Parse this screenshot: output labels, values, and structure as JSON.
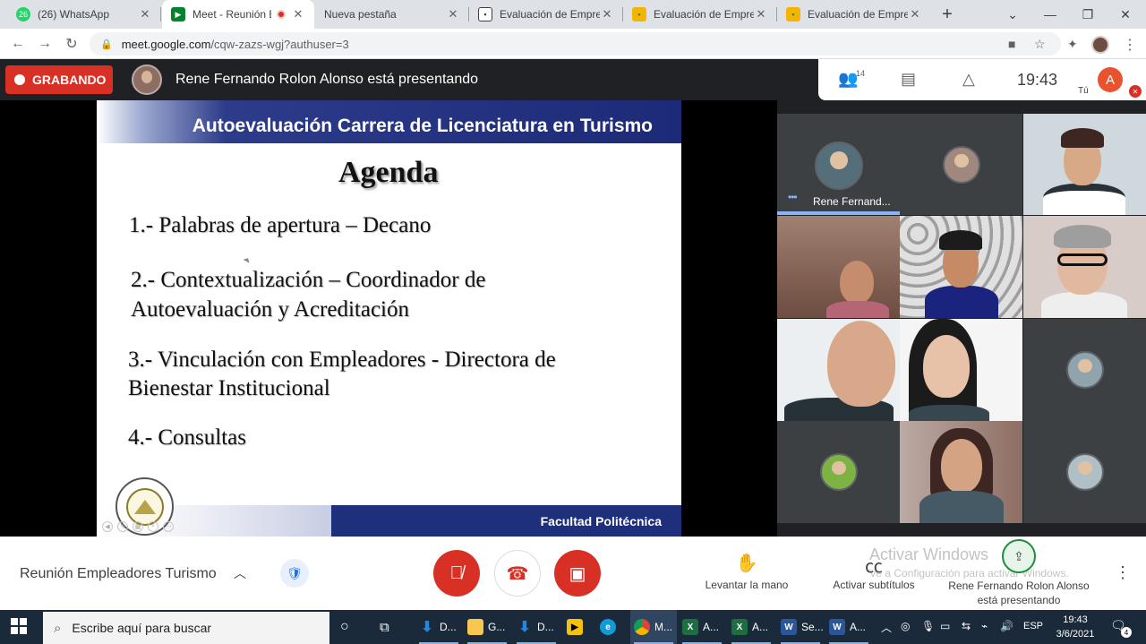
{
  "browser": {
    "tabs": [
      {
        "label": "(26) WhatsApp",
        "icon": "whatsapp-icon",
        "icon_text": "26",
        "color": "#25d366"
      },
      {
        "label": "Meet - Reunión Em",
        "icon": "google-meet-icon",
        "icon_text": "",
        "color": "#00832d"
      },
      {
        "label": "Nueva pestaña",
        "icon": "",
        "icon_text": "",
        "color": ""
      },
      {
        "label": "Evaluación de Empresa",
        "icon": "classroom-icon",
        "icon_text": "",
        "color": "#3c4043"
      },
      {
        "label": "Evaluación de Empresa",
        "icon": "classroom-icon",
        "icon_text": "",
        "color": "#f4b400"
      },
      {
        "label": "Evaluación de Empresa",
        "icon": "classroom-icon",
        "icon_text": "",
        "color": "#f4b400"
      }
    ],
    "url_host": "meet.google.com",
    "url_path": "/cqw-zazs-wgj?authuser=3"
  },
  "meet": {
    "recording_label": "GRABANDO",
    "presenting_text": "Rene Fernando Rolon Alonso está presentando",
    "participants_count": "14",
    "time": "19:43",
    "me_initial": "A",
    "me_label": "Tú",
    "meeting_name": "Reunión Empleadores Turismo",
    "raise_hand_label": "Levantar la mano",
    "captions_label": "Activar subtítulos",
    "present_label": "Rene Fernando Rolon Alonso está presentando",
    "watermark_title": "Activar Windows",
    "watermark_sub": "Ve a Configuración para activar Windows."
  },
  "slide": {
    "header": "Autoevaluación Carrera de Licenciatura en Turismo",
    "title": "Agenda",
    "items": [
      "1.- Palabras de apertura – Decano",
      "2.- Contextualización – Coordinador de",
      "Autoevaluación y Acreditación",
      "3.- Vinculación con Empleadores - Directora de",
      "Bienestar Institucional",
      "4.- Consultas"
    ],
    "footer": "Facultad Politécnica"
  },
  "tiles": {
    "first_name": "Rene Fernand..."
  },
  "taskbar": {
    "search_placeholder": "Escribe aquí para buscar",
    "apps": [
      {
        "label": "D...",
        "icon": "download-icon",
        "color": "#1e88e5"
      },
      {
        "label": "G...",
        "icon": "folder-icon",
        "color": "#f9c74f"
      },
      {
        "label": "D...",
        "icon": "download-icon",
        "color": "#1e88e5"
      },
      {
        "label": "",
        "icon": "player-icon",
        "color": "#f4c20d"
      },
      {
        "label": "",
        "icon": "edge-icon",
        "color": "#0f9bd7"
      },
      {
        "label": "M...",
        "icon": "chrome-icon",
        "color": "#db4437"
      },
      {
        "label": "A...",
        "icon": "excel-icon",
        "color": "#1d6f42"
      },
      {
        "label": "A...",
        "icon": "excel-icon",
        "color": "#1d6f42"
      },
      {
        "label": "Se...",
        "icon": "word-icon",
        "color": "#2b579a"
      },
      {
        "label": "A...",
        "icon": "word-icon",
        "color": "#2b579a"
      }
    ],
    "language": "ESP",
    "time": "19:43",
    "date": "3/6/2021",
    "notifications": "4"
  },
  "colors": {
    "record_red": "#d93025",
    "slide_blue": "#1e2f7c",
    "accent": "#1a73e8"
  }
}
